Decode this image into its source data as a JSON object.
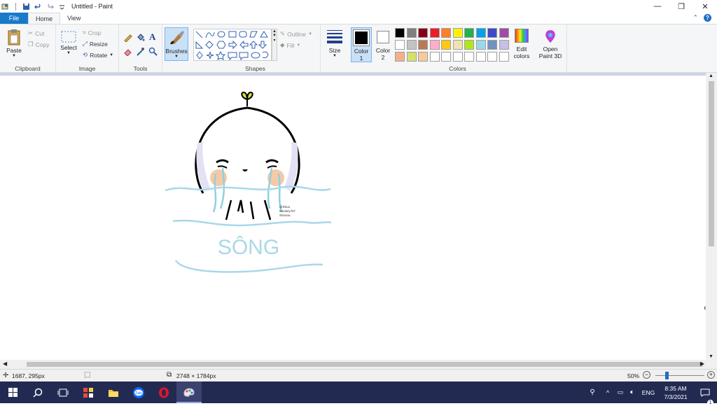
{
  "window": {
    "title": "Untitled - Paint",
    "minimize": "—",
    "restore": "❐",
    "close": "✕"
  },
  "tabs": {
    "file": "File",
    "home": "Home",
    "view": "View"
  },
  "tabs_right": {
    "collapse": "⌃",
    "help": "?"
  },
  "ribbon": {
    "clipboard": {
      "label": "Clipboard",
      "paste": "Paste",
      "cut": "Cut",
      "copy": "Copy"
    },
    "image": {
      "label": "Image",
      "select": "Select",
      "crop": "Crop",
      "resize": "Resize",
      "rotate": "Rotate"
    },
    "tools": {
      "label": "Tools"
    },
    "brushes": {
      "label": "Brushes"
    },
    "shapes": {
      "label": "Shapes",
      "outline": "Outline",
      "fill": "Fill"
    },
    "size": {
      "label": "Size"
    },
    "colors": {
      "label": "Colors",
      "color1": "Color",
      "color1_num": "1",
      "color2": "Color",
      "color2_num": "2",
      "edit_colors": "Edit",
      "edit_colors2": "colors",
      "open3d": "Open",
      "open3d2": "Paint 3D"
    }
  },
  "palette": {
    "row1": [
      "#000000",
      "#7f7f7f",
      "#880015",
      "#ed1c24",
      "#ff7f27",
      "#fff200",
      "#22b14c",
      "#00a2e8",
      "#3f48cc",
      "#a349a4"
    ],
    "row2": [
      "#ffffff",
      "#c3c3c3",
      "#b97a57",
      "#ffaec9",
      "#ffc90e",
      "#efe4b0",
      "#b5e61d",
      "#99d9ea",
      "#7092be",
      "#c8bfe7"
    ],
    "row3": [
      "#f5b08a",
      "#d7e06a",
      "#f8c99a",
      "#ffffff",
      "#ffffff",
      "#ffffff",
      "#ffffff",
      "#ffffff",
      "#ffffff",
      "#ffffff"
    ]
  },
  "drawing": {
    "river_text": "SÔNG",
    "credit_line1": "@Shuu",
    "credit_line2": "Mookey.f47",
    "credit_line3": "Shuuuu"
  },
  "status": {
    "cursor_pos": "1687, 295px",
    "canvas_size": "2748 × 1784px",
    "zoom": "50%"
  },
  "taskbar": {
    "time": "8:35 AM",
    "date": "7/3/2021",
    "lang": "ENG",
    "notif_count": "1"
  }
}
